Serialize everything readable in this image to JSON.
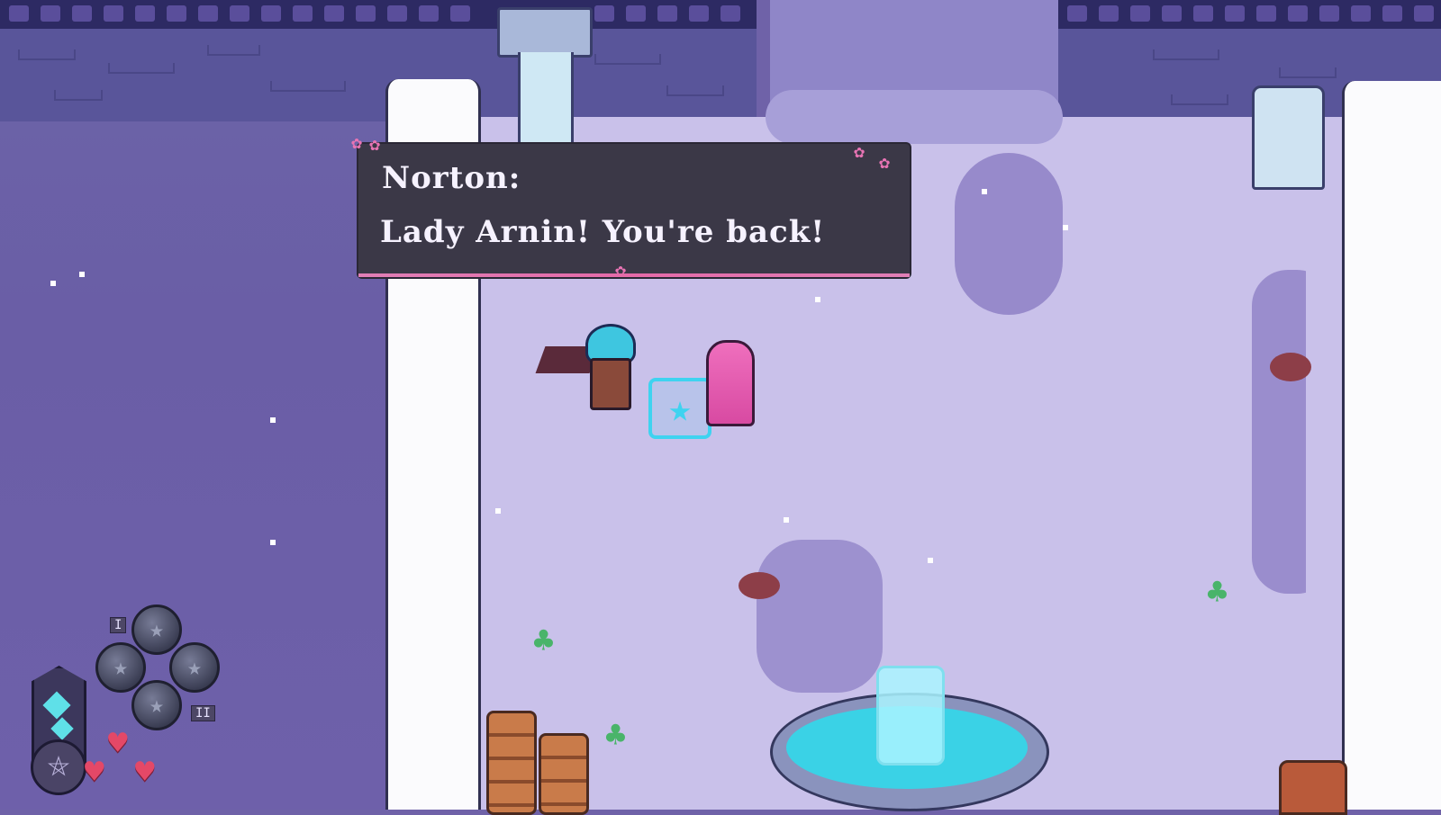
{
  "dialog": {
    "speaker": "Norton:",
    "line": "Lady Arnin! You're back!"
  },
  "hud": {
    "slot_labels": [
      "I",
      "II"
    ],
    "hearts": 3,
    "skill_orb_icon": "star-icon",
    "emblem_icon": "pentagram-icon",
    "crystal_icon": "crystal-icon"
  },
  "colors": {
    "dialog_bg": "#3b3847",
    "dialog_accent": "#e46aa8",
    "floor": "#c9c1ea",
    "wall": "#59559a",
    "water": "#3ad2e6",
    "heart": "#e44867"
  }
}
